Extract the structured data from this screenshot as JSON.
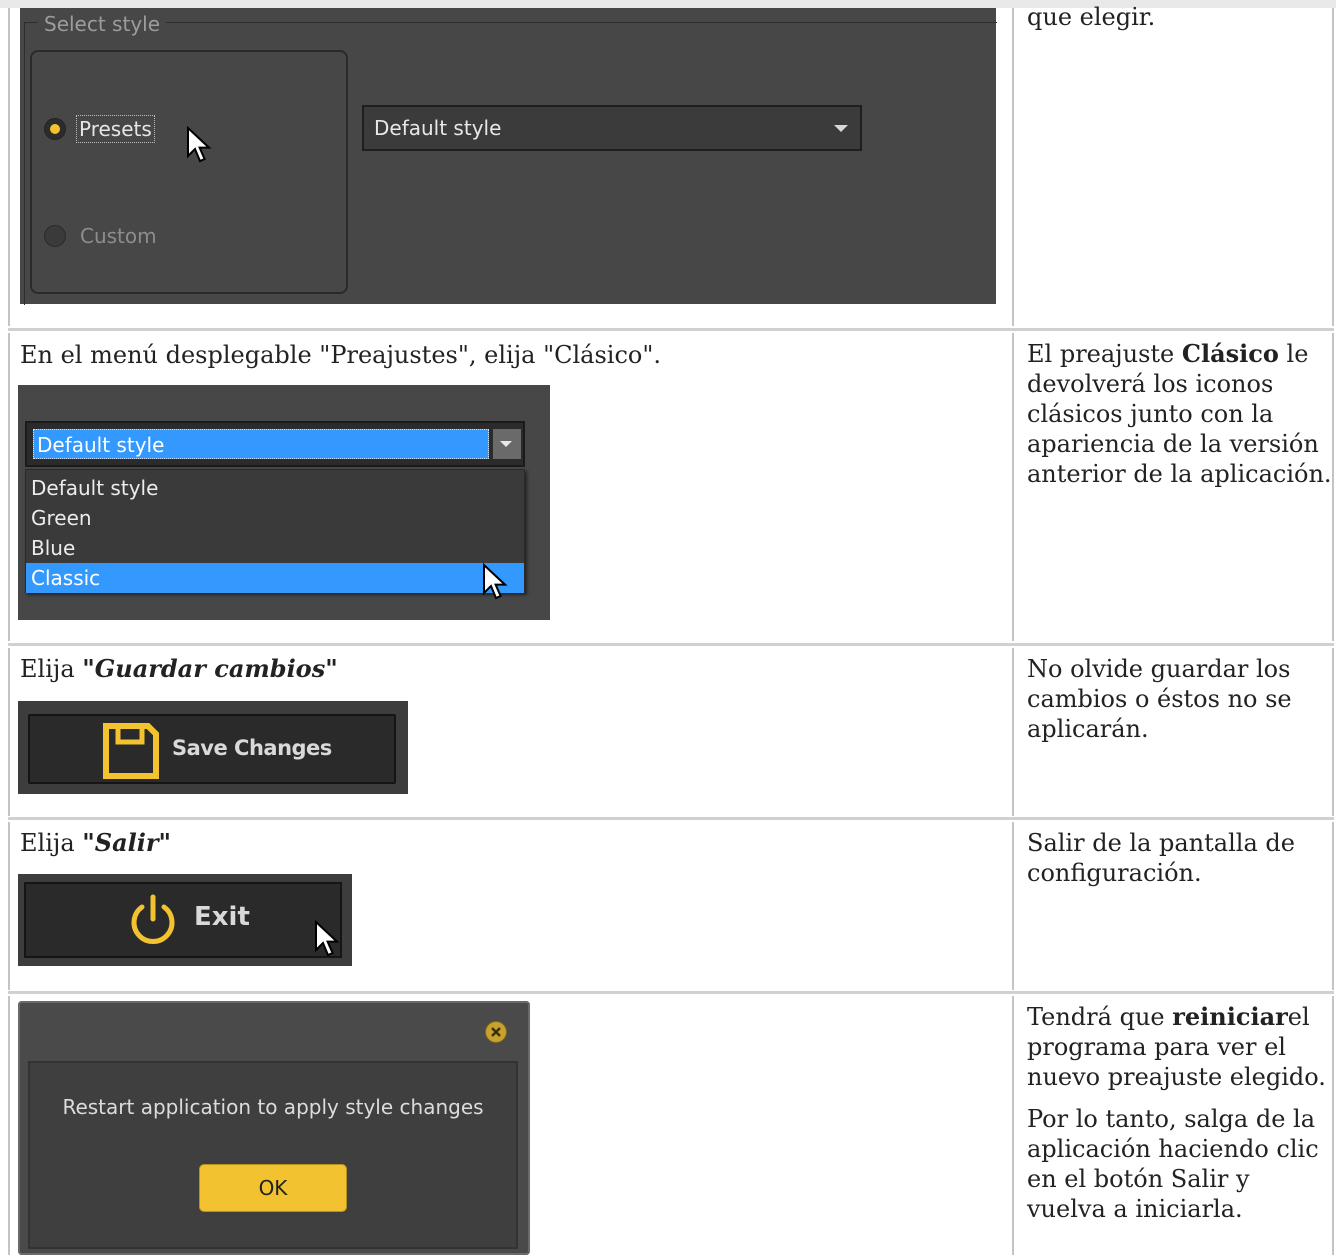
{
  "row1": {
    "group_title": "Select style",
    "radio_presets": "Presets",
    "radio_custom": "Custom",
    "dropdown_value": "Default style",
    "right_text": "que elegir."
  },
  "row2": {
    "instruction": "En el menú desplegable \"Preajustes\", elija \"Clásico\".",
    "dropdown_value": "Default style",
    "options": [
      "Default style",
      "Green",
      "Blue",
      "Classic"
    ],
    "right_pre": "El preajuste ",
    "right_bold": "Clásico",
    "right_post": " le devolverá los iconos clásicos junto con la apariencia de la versión anterior de la aplicación."
  },
  "row3": {
    "instruction_pre": "Elija ",
    "instruction_em": "\"Guardar cambios\"",
    "button_label": "Save Changes",
    "right_text": "No olvide guardar los cambios o éstos no se aplicarán."
  },
  "row4": {
    "instruction_pre": "Elija ",
    "instruction_em": "\"Salir\"",
    "button_label": "Exit",
    "right_text": "Salir de la pantalla de configuración."
  },
  "row5": {
    "dialog_message": "Restart application to apply style changes",
    "ok_label": "OK",
    "right_p1_pre": "Tendrá que ",
    "right_p1_bold": "reiniciar",
    "right_p1_post": "el programa para ver el nuevo preajuste elegido.",
    "right_p2": "Por lo tanto, salga de la aplicación haciendo clic en el botón Salir y vuelva a iniciarla."
  },
  "colors": {
    "accent_yellow": "#f2c230",
    "highlight_blue": "#3399ff",
    "dark_panel": "#474747"
  }
}
